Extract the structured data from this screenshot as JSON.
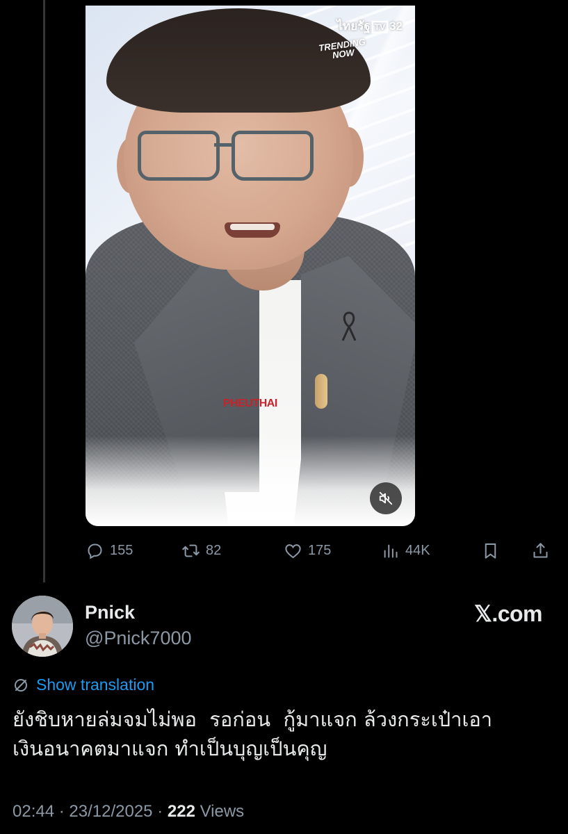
{
  "video": {
    "channel": "ไทยรัฐ",
    "channel_tv": "TV",
    "channel_num": "32",
    "trending_line1": "TRENDING",
    "trending_line2": "NOW",
    "shirt_text": "PHEUTHAI",
    "muted": true
  },
  "actions": {
    "replies": "155",
    "reposts": "82",
    "likes": "175",
    "views": "44K"
  },
  "author": {
    "name": "Pnick",
    "handle": "@Pnick7000"
  },
  "brand": "𝕏.com",
  "translate_label": "Show translation",
  "tweet": {
    "line1": "ยังชิบหายล่มจมไม่พอ  รอก่อน  กู้มาแจก ล้วงกระเป๋าเอา",
    "line2": "เงินอนาคตมาแจก ทำเป็นบุญเป็นคุญ"
  },
  "meta": {
    "time": "02:44",
    "date": "23/12/2025",
    "views_count": "222",
    "views_label": "Views"
  },
  "colors": {
    "background": "#000000",
    "text": "#e7e9ea",
    "secondary": "#8b98a5",
    "link": "#1d9bf0"
  }
}
